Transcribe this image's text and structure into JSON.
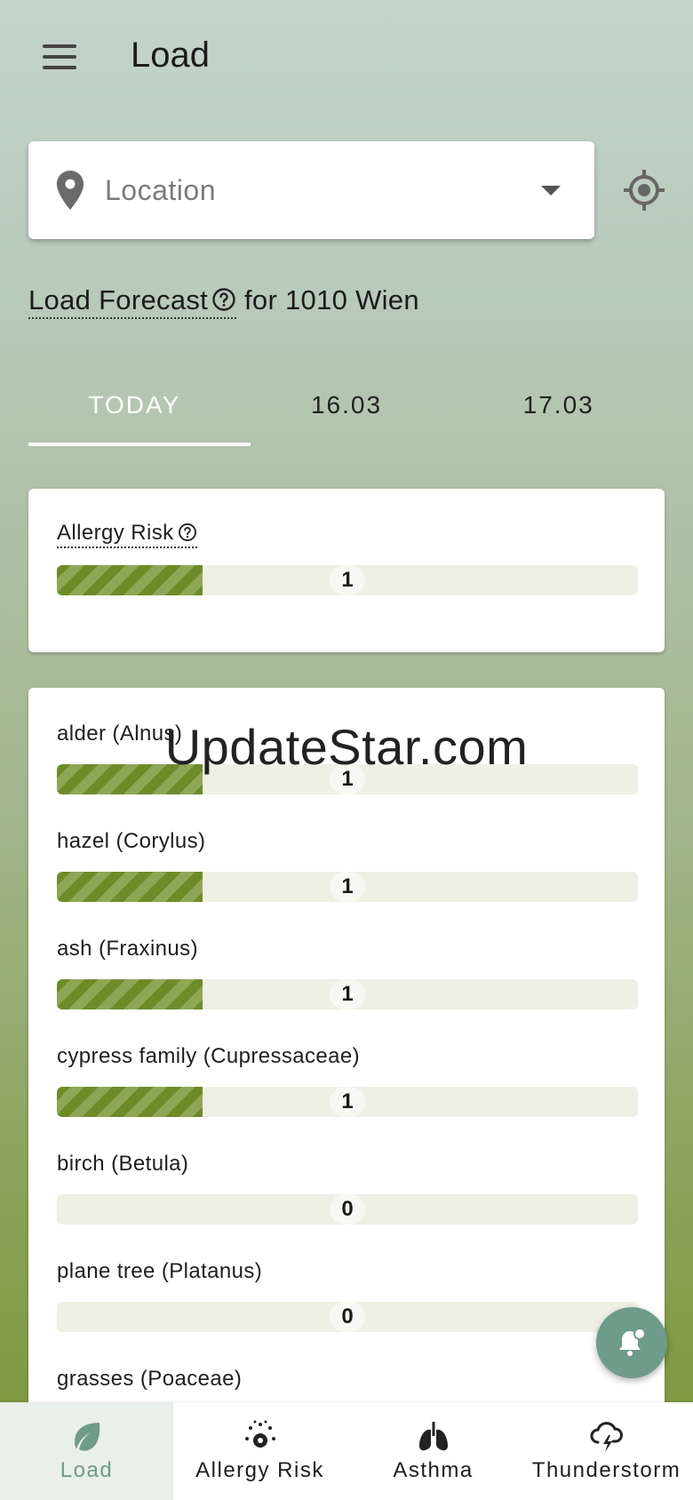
{
  "app": {
    "title": "Load"
  },
  "location": {
    "placeholder": "Location"
  },
  "forecast": {
    "link_text": "Load Forecast",
    "suffix": "for 1010 Wien"
  },
  "tabs": [
    {
      "label": "TODAY"
    },
    {
      "label": "16.03"
    },
    {
      "label": "17.03"
    }
  ],
  "allergy_risk": {
    "label": "Allergy Risk",
    "value": "1",
    "level": 0.25
  },
  "pollen": [
    {
      "label": "alder (Alnus)",
      "value": "1",
      "level": 0.25
    },
    {
      "label": "hazel (Corylus)",
      "value": "1",
      "level": 0.25
    },
    {
      "label": "ash (Fraxinus)",
      "value": "1",
      "level": 0.25
    },
    {
      "label": "cypress family (Cupressaceae)",
      "value": "1",
      "level": 0.25
    },
    {
      "label": "birch (Betula)",
      "value": "0",
      "level": 0
    },
    {
      "label": "plane tree (Platanus)",
      "value": "0",
      "level": 0
    },
    {
      "label": "grasses (Poaceae)"
    }
  ],
  "watermark": "UpdateStar.com",
  "nav": [
    {
      "label": "Load",
      "icon": "leaf-icon"
    },
    {
      "label": "Allergy Risk",
      "icon": "pollen-icon"
    },
    {
      "label": "Asthma",
      "icon": "lungs-icon"
    },
    {
      "label": "Thunderstorm",
      "icon": "storm-icon"
    }
  ],
  "colors": {
    "accent": "#6f9b8a",
    "bar_fill": "#6e8b2a",
    "bar_track": "#eef0e4"
  }
}
